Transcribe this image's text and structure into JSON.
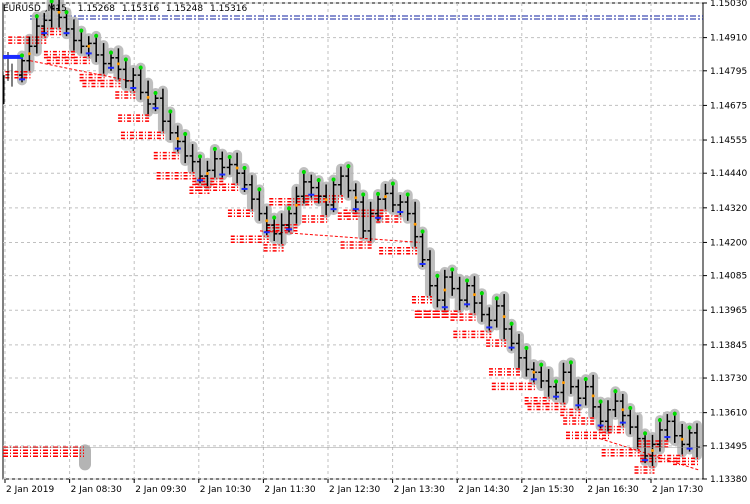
{
  "window": {
    "symbol": "EURUSD",
    "timeframe": "M15",
    "ohlc": [
      "1.15268",
      "1.15316",
      "1.15248",
      "1.15316"
    ]
  },
  "colors": {
    "background": "#ffffff",
    "grid": "#c0c0c0",
    "candle": "#000000",
    "trail": "#b4b4b4",
    "order_lines": "#ff0000",
    "marker_green": "#00dd00",
    "marker_blue": "#1b2bff",
    "marker_orange": "#ff9900",
    "top_lines": "#1020a0"
  },
  "chart_data": {
    "type": "candlestick",
    "grid": true,
    "price_scale": {
      "min": 1.1338,
      "max": 1.1503,
      "tick_labels": [
        "1.15030",
        "1.14910",
        "1.14795",
        "1.14675",
        "1.14555",
        "1.14440",
        "1.14320",
        "1.14200",
        "1.14085",
        "1.13965",
        "1.13845",
        "1.13730",
        "1.13610",
        "1.13495",
        "1.13380"
      ]
    },
    "time_labels": [
      "2 Jan 2019",
      "2 Jan 08:30",
      "2 Jan 09:30",
      "2 Jan 10:30",
      "2 Jan 11:30",
      "2 Jan 12:30",
      "2 Jan 13:30",
      "2 Jan 14:30",
      "2 Jan 15:30",
      "2 Jan 16:30",
      "2 Jan 17:30"
    ],
    "closes": [
      1.1483,
      1.1488,
      1.1495,
      1.1497,
      1.1501,
      1.1498,
      1.1494,
      1.149,
      1.1488,
      1.1489,
      1.1485,
      1.1482,
      1.1484,
      1.148,
      1.1476,
      1.1478,
      1.1472,
      1.1468,
      1.147,
      1.1462,
      1.1458,
      1.1455,
      1.145,
      1.1448,
      1.1443,
      1.1445,
      1.1449,
      1.1446,
      1.1447,
      1.1444,
      1.144,
      1.1435,
      1.143,
      1.1426,
      1.1423,
      1.1426,
      1.143,
      1.1436,
      1.1441,
      1.1439,
      1.1436,
      1.1433,
      1.144,
      1.1443,
      1.1438,
      1.1434,
      1.1424,
      1.143,
      1.1435,
      1.1437,
      1.1433,
      1.1434,
      1.143,
      1.1422,
      1.1414,
      1.1405,
      1.14,
      1.1408,
      1.1404,
      1.14,
      1.1405,
      1.1399,
      1.1395,
      1.1393,
      1.1398,
      1.139,
      1.1385,
      1.138,
      1.1376,
      1.1375,
      1.1372,
      1.137,
      1.1368,
      1.1375,
      1.137,
      1.1366,
      1.137,
      1.1363,
      1.1358,
      1.1362,
      1.1365,
      1.136,
      1.1356,
      1.1352,
      1.1346,
      1.135,
      1.1355,
      1.1358,
      1.1353,
      1.135,
      1.1354,
      1.1349
    ]
  }
}
